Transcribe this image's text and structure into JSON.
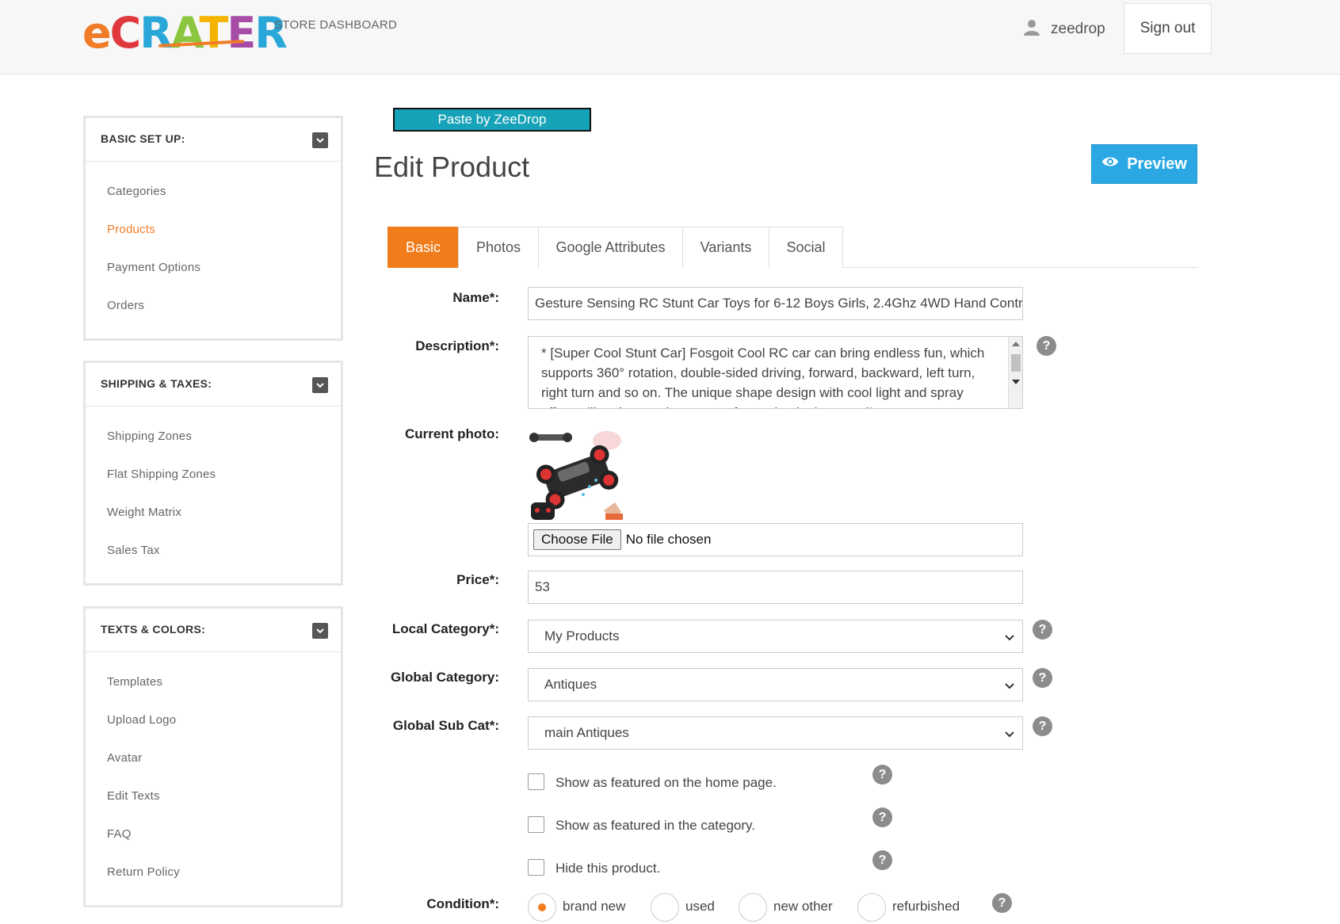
{
  "header": {
    "logo": [
      "e",
      "C",
      "R",
      "A",
      "T",
      "E",
      "R"
    ],
    "dashboard_link": "STORE DASHBOARD",
    "username": "zeedrop",
    "signout_label": "Sign out"
  },
  "sidebar": {
    "basic_setup": {
      "title": "BASIC SET UP:",
      "items": [
        "Categories",
        "Products",
        "Payment Options",
        "Orders"
      ]
    },
    "shipping": {
      "title": "SHIPPING & TAXES:",
      "items": [
        "Shipping Zones",
        "Flat Shipping Zones",
        "Weight Matrix",
        "Sales Tax"
      ]
    },
    "texts": {
      "title": "TEXTS & COLORS:",
      "items": [
        "Templates",
        "Upload Logo",
        "Avatar",
        "Edit Texts",
        "FAQ",
        "Return Policy"
      ]
    }
  },
  "main": {
    "zeedrop_button": "Paste by ZeeDrop",
    "page_title": "Edit Product",
    "preview_label": "Preview",
    "tabs": [
      "Basic",
      "Photos",
      "Google Attributes",
      "Variants",
      "Social"
    ],
    "form": {
      "name_label": "Name*:",
      "name_value": "Gesture Sensing RC Stunt Car Toys for 6-12 Boys Girls, 2.4Ghz 4WD Hand Contr",
      "description_label": "Description*:",
      "description_value": "* [Super Cool Stunt Car] Fosgoit Cool RC car can bring endless fun, which supports 360° rotation, double-sided driving, forward, backward, left turn, right turn and so on. The unique shape design with cool light and spray effect will make you the center of attention in the crowd!",
      "photo_label": "Current photo:",
      "file_button": "Choose File",
      "file_status": "No file chosen",
      "price_label": "Price*:",
      "price_value": "53",
      "local_category_label": "Local Category*:",
      "local_category_value": "My Products",
      "global_category_label": "Global Category:",
      "global_category_value": "Antiques",
      "global_subcat_label": "Global Sub Cat*:",
      "global_subcat_value": "main Antiques",
      "featured_home_label": "Show as featured on the home page.",
      "featured_category_label": "Show as featured in the category.",
      "hide_label": "Hide this product.",
      "condition_label": "Condition*:",
      "conditions": [
        "brand new",
        "used",
        "new other",
        "refurbished"
      ],
      "condition_selected": "brand new",
      "help_glyph": "?"
    }
  },
  "colors": {
    "accent": "#f07c1c",
    "preview_blue": "#2ba8e4",
    "zeedrop_teal": "#16a2b8"
  }
}
